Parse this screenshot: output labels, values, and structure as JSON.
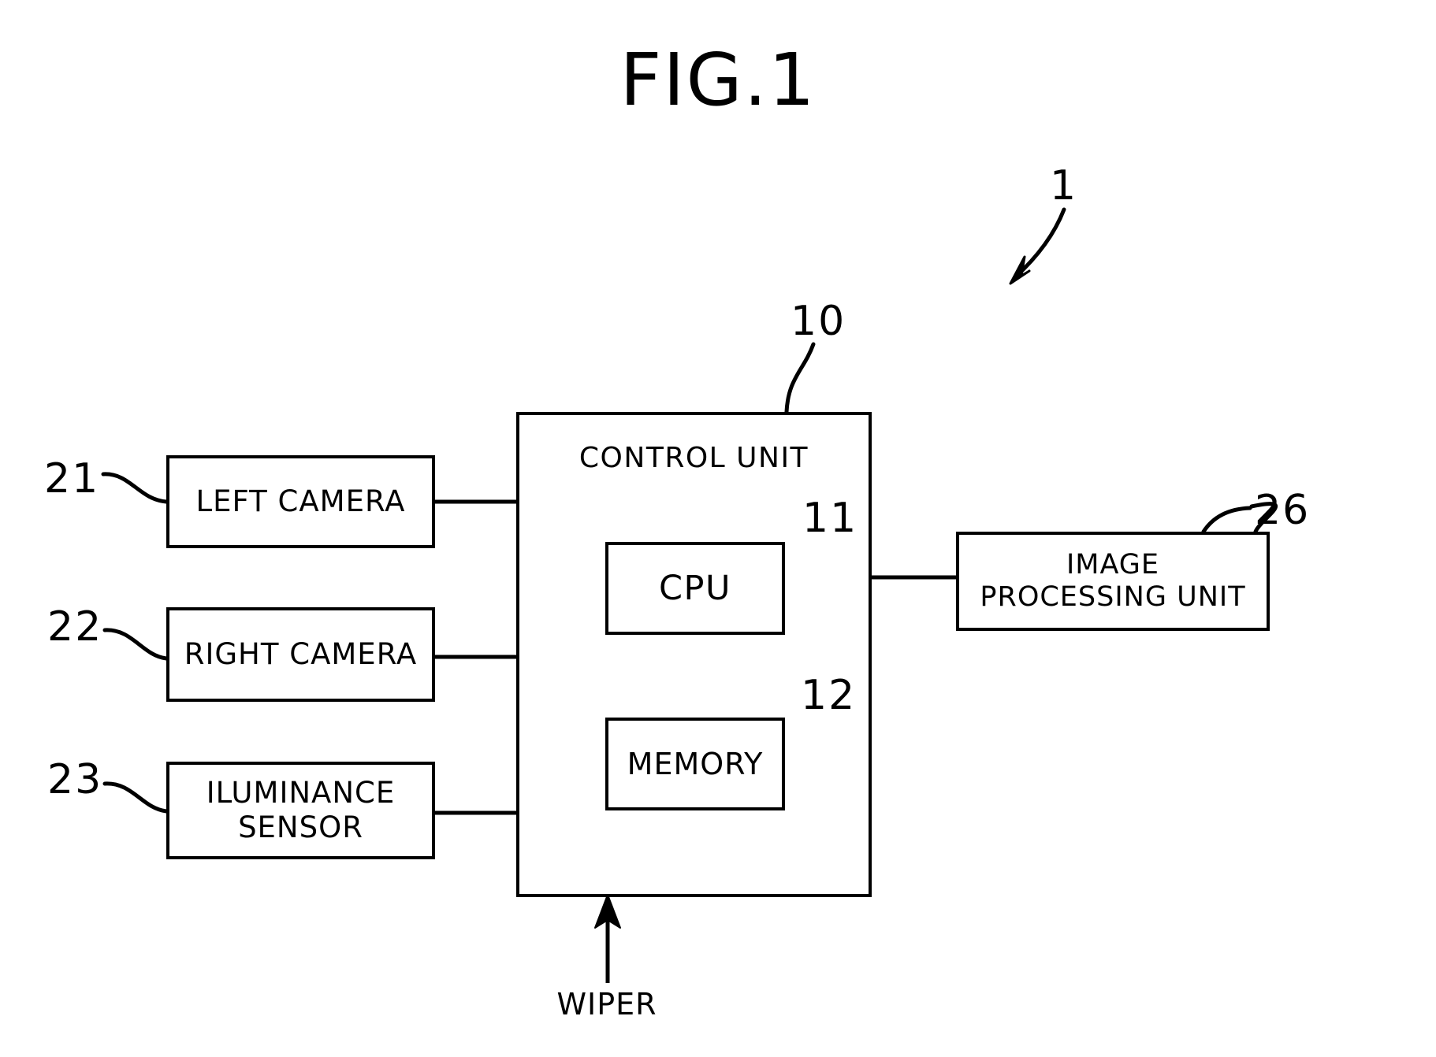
{
  "figure": {
    "title": "FIG.1",
    "caption_wiper": "WIPER"
  },
  "diagram": {
    "type": "block-diagram",
    "blocks": [
      {
        "id": "control-unit",
        "label": "CONTROL UNIT",
        "ref": "10"
      },
      {
        "id": "left-camera",
        "label": "LEFT CAMERA",
        "ref": "21"
      },
      {
        "id": "right-camera",
        "label": "RIGHT CAMERA",
        "ref": "22"
      },
      {
        "id": "iluminance-sensor",
        "label": "ILUMINANCE\nSENSOR",
        "ref": "23"
      },
      {
        "id": "cpu",
        "label": "CPU",
        "ref": "11"
      },
      {
        "id": "memory",
        "label": "MEMORY",
        "ref": "12"
      },
      {
        "id": "image-processing-unit",
        "label": "IMAGE\nPROCESSING UNIT",
        "ref": "26"
      }
    ],
    "reference_numerals": {
      "system": "1",
      "control_unit": "10",
      "cpu": "11",
      "memory": "12",
      "left_camera": "21",
      "right_camera": "22",
      "iluminance_sensor": "23",
      "image_processing_unit": "26"
    },
    "connections": [
      {
        "from": "left-camera",
        "to": "control-unit",
        "style": "line"
      },
      {
        "from": "right-camera",
        "to": "control-unit",
        "style": "line"
      },
      {
        "from": "iluminance-sensor",
        "to": "control-unit",
        "style": "line"
      },
      {
        "from": "control-unit",
        "to": "image-processing-unit",
        "style": "line"
      },
      {
        "from": "cpu",
        "to": "memory",
        "style": "line"
      },
      {
        "from": "wiper",
        "to": "control-unit",
        "style": "arrow"
      }
    ],
    "colors": {
      "stroke": "#000000",
      "background": "#ffffff"
    }
  }
}
